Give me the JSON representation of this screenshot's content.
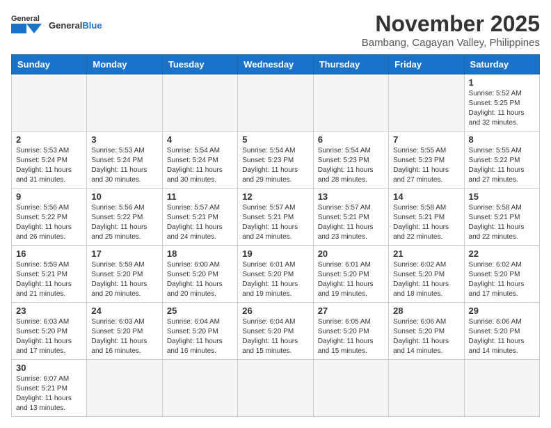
{
  "header": {
    "logo_general": "General",
    "logo_blue": "Blue",
    "month_title": "November 2025",
    "subtitle": "Bambang, Cagayan Valley, Philippines"
  },
  "days_of_week": [
    "Sunday",
    "Monday",
    "Tuesday",
    "Wednesday",
    "Thursday",
    "Friday",
    "Saturday"
  ],
  "weeks": [
    [
      {
        "day": "",
        "info": ""
      },
      {
        "day": "",
        "info": ""
      },
      {
        "day": "",
        "info": ""
      },
      {
        "day": "",
        "info": ""
      },
      {
        "day": "",
        "info": ""
      },
      {
        "day": "",
        "info": ""
      },
      {
        "day": "1",
        "info": "Sunrise: 5:52 AM\nSunset: 5:25 PM\nDaylight: 11 hours\nand 32 minutes."
      }
    ],
    [
      {
        "day": "2",
        "info": "Sunrise: 5:53 AM\nSunset: 5:24 PM\nDaylight: 11 hours\nand 31 minutes."
      },
      {
        "day": "3",
        "info": "Sunrise: 5:53 AM\nSunset: 5:24 PM\nDaylight: 11 hours\nand 30 minutes."
      },
      {
        "day": "4",
        "info": "Sunrise: 5:54 AM\nSunset: 5:24 PM\nDaylight: 11 hours\nand 30 minutes."
      },
      {
        "day": "5",
        "info": "Sunrise: 5:54 AM\nSunset: 5:23 PM\nDaylight: 11 hours\nand 29 minutes."
      },
      {
        "day": "6",
        "info": "Sunrise: 5:54 AM\nSunset: 5:23 PM\nDaylight: 11 hours\nand 28 minutes."
      },
      {
        "day": "7",
        "info": "Sunrise: 5:55 AM\nSunset: 5:23 PM\nDaylight: 11 hours\nand 27 minutes."
      },
      {
        "day": "8",
        "info": "Sunrise: 5:55 AM\nSunset: 5:22 PM\nDaylight: 11 hours\nand 27 minutes."
      }
    ],
    [
      {
        "day": "9",
        "info": "Sunrise: 5:56 AM\nSunset: 5:22 PM\nDaylight: 11 hours\nand 26 minutes."
      },
      {
        "day": "10",
        "info": "Sunrise: 5:56 AM\nSunset: 5:22 PM\nDaylight: 11 hours\nand 25 minutes."
      },
      {
        "day": "11",
        "info": "Sunrise: 5:57 AM\nSunset: 5:21 PM\nDaylight: 11 hours\nand 24 minutes."
      },
      {
        "day": "12",
        "info": "Sunrise: 5:57 AM\nSunset: 5:21 PM\nDaylight: 11 hours\nand 24 minutes."
      },
      {
        "day": "13",
        "info": "Sunrise: 5:57 AM\nSunset: 5:21 PM\nDaylight: 11 hours\nand 23 minutes."
      },
      {
        "day": "14",
        "info": "Sunrise: 5:58 AM\nSunset: 5:21 PM\nDaylight: 11 hours\nand 22 minutes."
      },
      {
        "day": "15",
        "info": "Sunrise: 5:58 AM\nSunset: 5:21 PM\nDaylight: 11 hours\nand 22 minutes."
      }
    ],
    [
      {
        "day": "16",
        "info": "Sunrise: 5:59 AM\nSunset: 5:21 PM\nDaylight: 11 hours\nand 21 minutes."
      },
      {
        "day": "17",
        "info": "Sunrise: 5:59 AM\nSunset: 5:20 PM\nDaylight: 11 hours\nand 20 minutes."
      },
      {
        "day": "18",
        "info": "Sunrise: 6:00 AM\nSunset: 5:20 PM\nDaylight: 11 hours\nand 20 minutes."
      },
      {
        "day": "19",
        "info": "Sunrise: 6:01 AM\nSunset: 5:20 PM\nDaylight: 11 hours\nand 19 minutes."
      },
      {
        "day": "20",
        "info": "Sunrise: 6:01 AM\nSunset: 5:20 PM\nDaylight: 11 hours\nand 19 minutes."
      },
      {
        "day": "21",
        "info": "Sunrise: 6:02 AM\nSunset: 5:20 PM\nDaylight: 11 hours\nand 18 minutes."
      },
      {
        "day": "22",
        "info": "Sunrise: 6:02 AM\nSunset: 5:20 PM\nDaylight: 11 hours\nand 17 minutes."
      }
    ],
    [
      {
        "day": "23",
        "info": "Sunrise: 6:03 AM\nSunset: 5:20 PM\nDaylight: 11 hours\nand 17 minutes."
      },
      {
        "day": "24",
        "info": "Sunrise: 6:03 AM\nSunset: 5:20 PM\nDaylight: 11 hours\nand 16 minutes."
      },
      {
        "day": "25",
        "info": "Sunrise: 6:04 AM\nSunset: 5:20 PM\nDaylight: 11 hours\nand 16 minutes."
      },
      {
        "day": "26",
        "info": "Sunrise: 6:04 AM\nSunset: 5:20 PM\nDaylight: 11 hours\nand 15 minutes."
      },
      {
        "day": "27",
        "info": "Sunrise: 6:05 AM\nSunset: 5:20 PM\nDaylight: 11 hours\nand 15 minutes."
      },
      {
        "day": "28",
        "info": "Sunrise: 6:06 AM\nSunset: 5:20 PM\nDaylight: 11 hours\nand 14 minutes."
      },
      {
        "day": "29",
        "info": "Sunrise: 6:06 AM\nSunset: 5:20 PM\nDaylight: 11 hours\nand 14 minutes."
      }
    ],
    [
      {
        "day": "30",
        "info": "Sunrise: 6:07 AM\nSunset: 5:21 PM\nDaylight: 11 hours\nand 13 minutes."
      },
      {
        "day": "",
        "info": ""
      },
      {
        "day": "",
        "info": ""
      },
      {
        "day": "",
        "info": ""
      },
      {
        "day": "",
        "info": ""
      },
      {
        "day": "",
        "info": ""
      },
      {
        "day": "",
        "info": ""
      }
    ]
  ]
}
